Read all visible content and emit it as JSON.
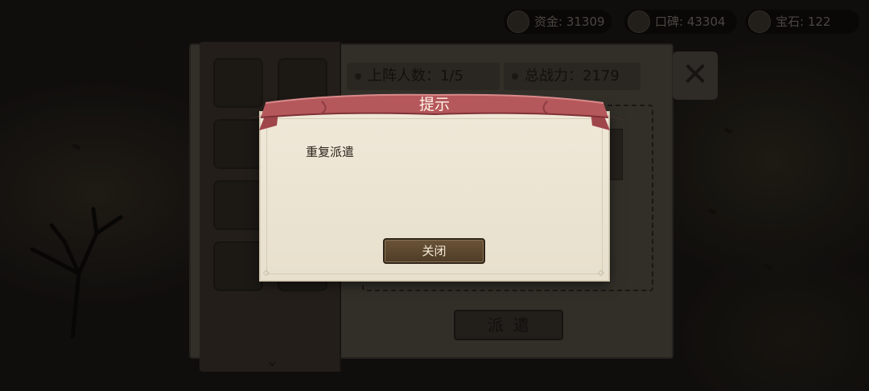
{
  "resources": [
    {
      "icon": "coin-icon",
      "label": "资金: 31309"
    },
    {
      "icon": "scroll-icon",
      "label": "口碑: 43304"
    },
    {
      "icon": "gem-icon",
      "label": "宝石: 122"
    }
  ],
  "panel": {
    "deployed_label": "上阵人数：1/5",
    "power_label": "总战力：2179",
    "dispatch_button": "派遣"
  },
  "modal": {
    "title": "提示",
    "message": "重复派遣",
    "close_button": "关闭"
  },
  "colors": {
    "ribbon": "#b5585b",
    "ribbon_dark": "#8e3b40",
    "paper": "#ece5d4",
    "button": "#5c4730"
  }
}
